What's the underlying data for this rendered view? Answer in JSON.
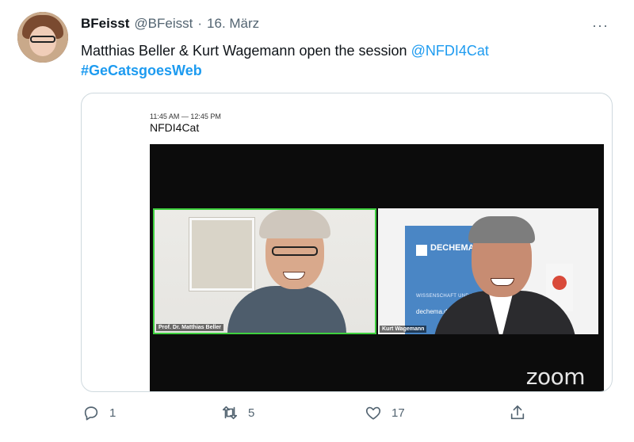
{
  "author": {
    "name": "BFeisst",
    "handle": "@BFeisst",
    "separator": "·",
    "date": "16. März"
  },
  "more_label": "···",
  "tweet": {
    "text": "Matthias Beller & Kurt Wagemann open the session ",
    "mention": "@NFDI4Cat",
    "hashtag": "#GeCatsgoesWeb"
  },
  "card": {
    "time_range": "11:45 AM — 12:45 PM",
    "title": "NFDI4Cat",
    "participant1": "Prof. Dr. Matthias Beller",
    "participant2": "Kurt Wagemann",
    "banner_brand": "DECHEMA",
    "banner_sub": "WISSENSCHAFT UND INDUSTRI",
    "banner_url": "dechema.de",
    "watermark": "zoom"
  },
  "actions": {
    "reply_count": "1",
    "retweet_count": "5",
    "like_count": "17"
  },
  "colors": {
    "accent": "#1d9bf0",
    "active_speaker": "#3fd13f"
  }
}
